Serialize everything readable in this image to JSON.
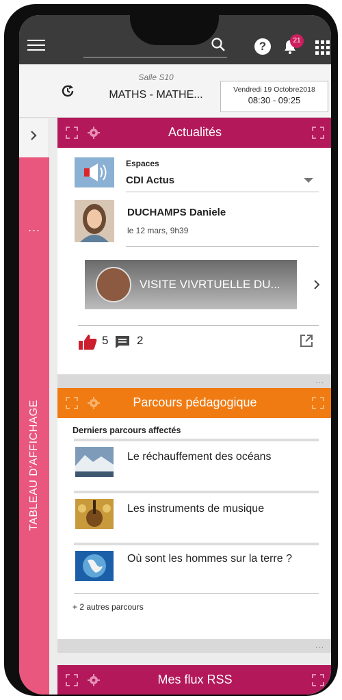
{
  "topbar": {
    "notification_count": "21"
  },
  "course": {
    "room": "Salle S10",
    "subject": "MATHS - MATHE...",
    "date": "Vendredi 19 Octobre2018",
    "time": "08:30 - 09:25"
  },
  "sidebar": {
    "dots": "...",
    "label": "TABLEAU D'AFFICHAGE"
  },
  "actualites": {
    "title": "Actualités",
    "espaces_label": "Espaces",
    "espaces_value": "CDI Actus",
    "author": "DUCHAMPS Daniele",
    "date": "le 12 mars, 9h39",
    "banner_text": "VISITE VIVRTUELLE DU...",
    "likes": "5",
    "comments": "2",
    "footer_dots": "..."
  },
  "parcours": {
    "title": "Parcours pédagogique",
    "subtitle": "Derniers parcours affectés",
    "items": [
      {
        "label": "Le réchauffement des océans"
      },
      {
        "label": "Les instruments de musique"
      },
      {
        "label": "Où sont les hommes sur la terre ?"
      }
    ],
    "more": "+ 2 autres parcours",
    "footer_dots": "..."
  },
  "rss": {
    "title": "Mes flux RSS"
  },
  "colors": {
    "actualites": "#b3185a",
    "parcours": "#f07b12",
    "sidebar": "#e9567e",
    "topbar": "#3b3b3b"
  }
}
